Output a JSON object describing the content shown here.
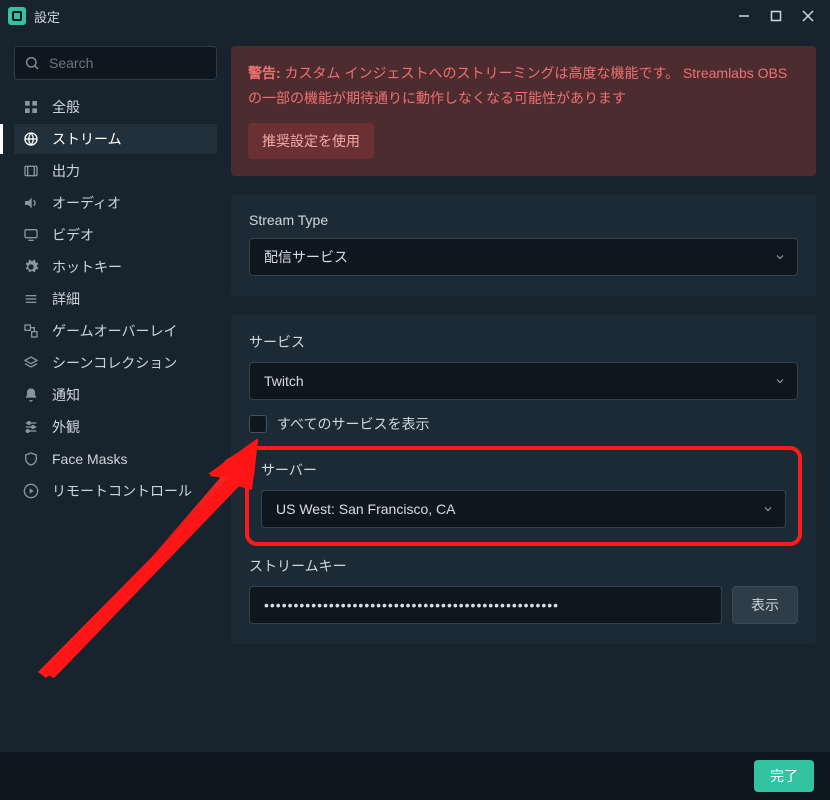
{
  "window": {
    "title": "設定"
  },
  "search": {
    "placeholder": "Search"
  },
  "sidebar": {
    "items": [
      {
        "label": "全般",
        "icon": "grid-icon"
      },
      {
        "label": "ストリーム",
        "icon": "globe-icon",
        "active": true
      },
      {
        "label": "出力",
        "icon": "film-icon"
      },
      {
        "label": "オーディオ",
        "icon": "volume-icon"
      },
      {
        "label": "ビデオ",
        "icon": "monitor-icon"
      },
      {
        "label": "ホットキー",
        "icon": "gear-icon"
      },
      {
        "label": "詳細",
        "icon": "menu-icon"
      },
      {
        "label": "ゲームオーバーレイ",
        "icon": "overlay-icon"
      },
      {
        "label": "シーンコレクション",
        "icon": "scenes-icon"
      },
      {
        "label": "通知",
        "icon": "bell-icon"
      },
      {
        "label": "外観",
        "icon": "sliders-icon"
      },
      {
        "label": "Face Masks",
        "icon": "mask-icon"
      },
      {
        "label": "リモートコントロール",
        "icon": "play-icon"
      }
    ]
  },
  "warning": {
    "label": "警告:",
    "text": " カスタム インジェストへのストリーミングは高度な機能です。 Streamlabs OBS の一部の機能が期待通りに動作しなくなる可能性があります",
    "button": "推奨設定を使用"
  },
  "stream_type": {
    "label": "Stream Type",
    "value": "配信サービス"
  },
  "service": {
    "label": "サービス",
    "value": "Twitch",
    "show_all_label": "すべてのサービスを表示"
  },
  "server": {
    "label": "サーバー",
    "value": "US West: San Francisco, CA"
  },
  "stream_key": {
    "label": "ストリームキー",
    "value_masked": "••••••••••••••••••••••••••••••••••••••••••••••••••",
    "reveal": "表示"
  },
  "footer": {
    "done": "完了"
  }
}
